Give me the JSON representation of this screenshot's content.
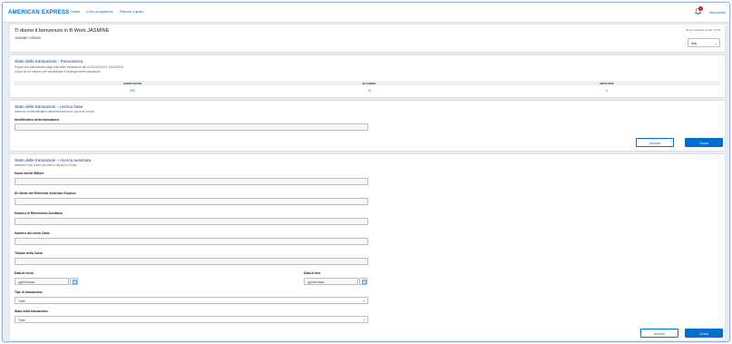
{
  "header": {
    "brand": "AMERICAN EXPRESS",
    "nav": [
      "Home",
      "Il mio programma",
      "Risorse e guide"
    ],
    "notification_count": "2",
    "user": "Disconnetti"
  },
  "welcome": {
    "title": "Ti diamo il benvenuto in B Work JASMINE",
    "subtitle": "JASMINE CURIANI",
    "session_note": "Rimai sessione scade: 10:56",
    "language": "Italy"
  },
  "overview": {
    "title": "Stato della transazione - Panoramica",
    "desc1": "Segue una panoramica degli stati delle transazioni dal al 10/10/2024 e 13/10/2024",
    "desc2": "Clicca su un numero per visualizzare il riepilogo delle transazioni",
    "columns": [
      "COMPLETATE",
      "IN CORSO",
      "RIFIUTATE"
    ],
    "values": [
      "200",
      "10",
      "0"
    ]
  },
  "basic": {
    "title": "Stato delle transazioni – ricerca base",
    "desc": "Inserisci un identificativo della transazione e clicca su Cerca.",
    "field_label": "Identificativo della transazione",
    "cancel": "Annulla",
    "search": "Cerca"
  },
  "advanced": {
    "title": "Stato delle transazioni – ricerca avanzata",
    "desc": "Inserisci i tuoi criteri qui sotto e clicca su Cerca.",
    "fields": [
      "Nome utente BWork",
      "ID Utente del Referente American Express",
      "Numero di Riferimento Ancillario",
      "Numero del conto Carta",
      "Titolare della Carta"
    ],
    "date_from_label": "Data di inizio",
    "date_to_label": "Data di fine",
    "date_placeholder": "gg/mm/aaaa",
    "type_label": "Tipo di transazione",
    "type_value": "Tutto",
    "status_label": "Stato della transazione",
    "status_value": "Tutto",
    "cancel": "Annulla",
    "search": "Cerca"
  },
  "colors": {
    "accent": "#006fcf",
    "badge": "#c8102e"
  }
}
